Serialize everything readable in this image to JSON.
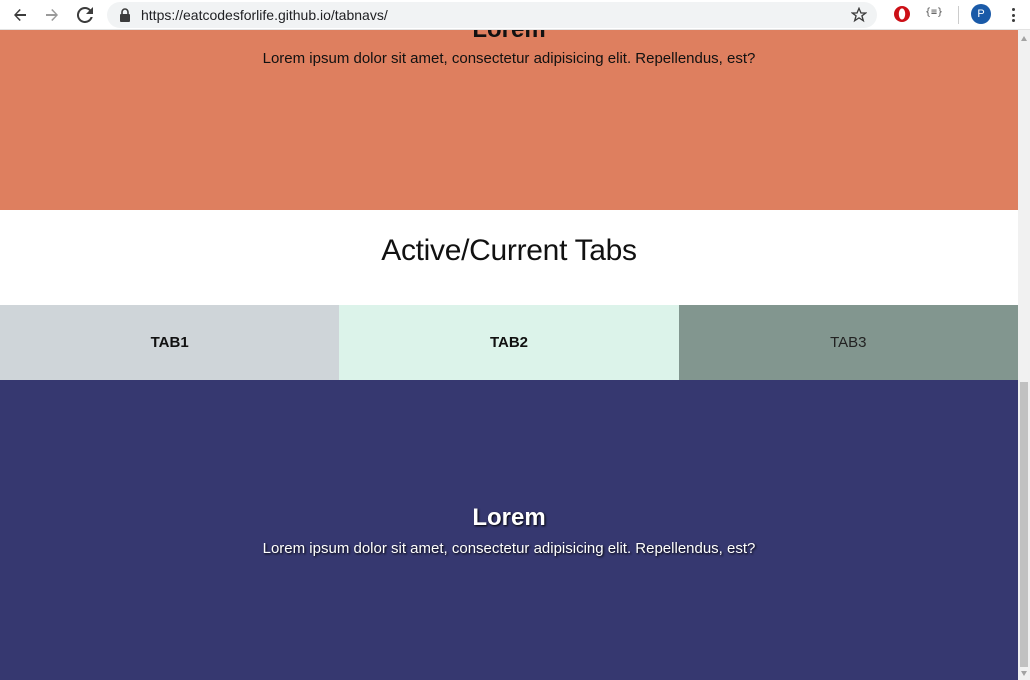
{
  "browser": {
    "url": "https://eatcodesforlife.github.io/tabnavs/",
    "extension_json_label": "{≡}",
    "avatar_letter": "P",
    "icons": [
      "back-arrow-icon",
      "forward-arrow-icon",
      "reload-icon",
      "lock-icon",
      "star-icon",
      "opera-icon",
      "json-icon",
      "menu-icon"
    ]
  },
  "top_section": {
    "heading": "Lorem",
    "paragraph": "Lorem ipsum dolor sit amet, consectetur adipisicing elit. Repellendus, est?",
    "color": "#de7f5f"
  },
  "page_heading": "Active/Current Tabs",
  "tabs": [
    {
      "label": "TAB1",
      "color": "#cfd5d9"
    },
    {
      "label": "TAB2",
      "color": "#dcf3ea"
    },
    {
      "label": "TAB3",
      "color": "#82968f"
    }
  ],
  "bottom_section": {
    "heading": "Lorem",
    "paragraph": "Lorem ipsum dolor sit amet, consectetur adipisicing elit. Repellendus, est?",
    "color": "#363870"
  }
}
